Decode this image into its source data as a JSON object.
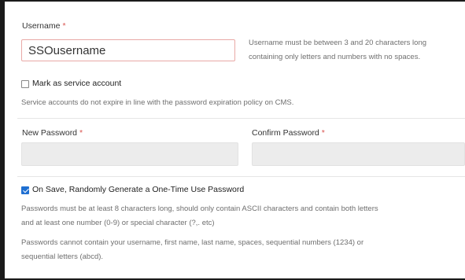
{
  "username": {
    "label": "Username",
    "required_mark": "*",
    "value": "SSOusername",
    "help_line1": "Username must be between 3 and 20 characters long",
    "help_line2": "containing only letters and numbers with no spaces."
  },
  "service_account": {
    "label": "Mark as service account",
    "checked": false,
    "help": "Service accounts do not expire in line with the password expiration policy on CMS."
  },
  "new_password": {
    "label": "New Password",
    "required_mark": "*",
    "value": ""
  },
  "confirm_password": {
    "label": "Confirm Password",
    "required_mark": "*",
    "value": ""
  },
  "one_time_password": {
    "label": "On Save, Randomly Generate a One-Time Use Password",
    "checked": true
  },
  "password_rules": {
    "line1": "Passwords must be at least 8 characters long, should only contain ASCII characters and contain both letters",
    "line2": "and at least one number (0-9) or special character (?,. etc)",
    "line3": "Passwords cannot contain your username, first name, last name, spaces, sequential numbers (1234) or",
    "line4": "sequential letters (abcd)."
  },
  "colors": {
    "checkbox_accent": "#1f6fd1",
    "required": "#d9534f"
  }
}
